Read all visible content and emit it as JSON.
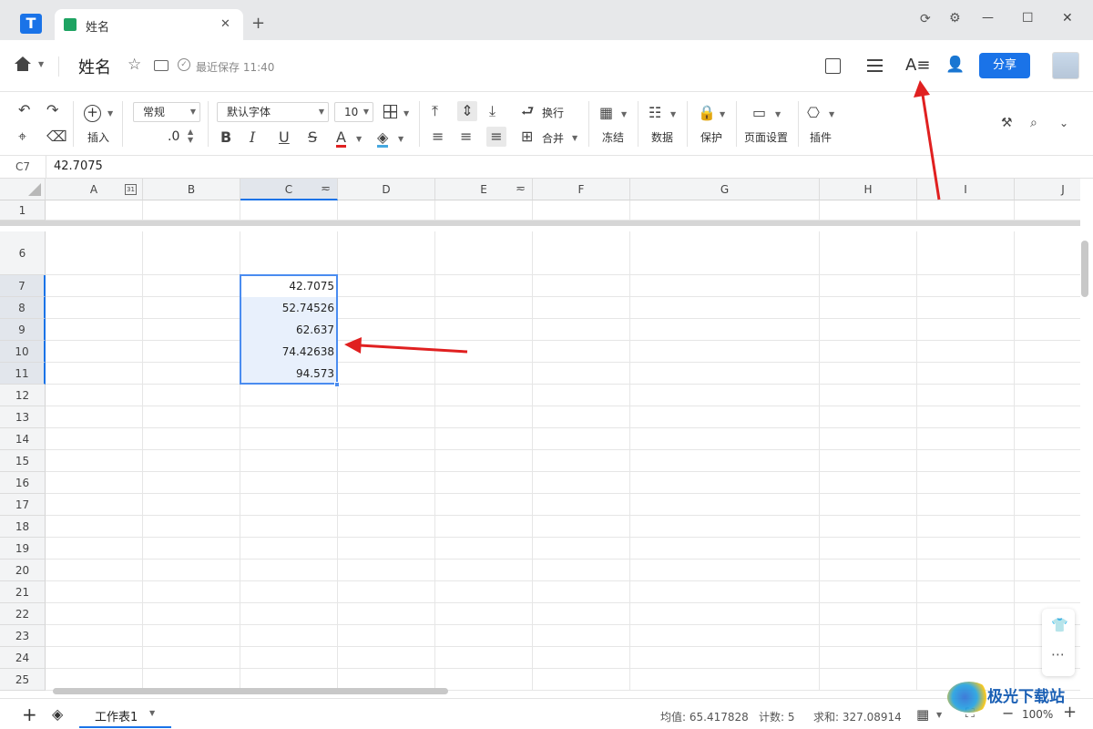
{
  "window": {
    "tab_title": "姓名",
    "new_tab": "+",
    "restore_icon": "⟳",
    "settings_icon": "⚙",
    "minimize": "—",
    "maximize": "☐",
    "close": "✕"
  },
  "doc": {
    "title": "姓名",
    "save_status": "最近保存 11:40",
    "share_label": "分享"
  },
  "toolbar": {
    "insert_label": "插入",
    "number_format": "常规",
    "decimal": ".0",
    "font_family": "默认字体",
    "font_size": "10",
    "wrap_label": "换行",
    "merge_label": "合并",
    "freeze_label": "冻结",
    "data_label": "数据",
    "protect_label": "保护",
    "page_setup_label": "页面设置",
    "plugin_label": "插件",
    "bold": "B",
    "italic": "I",
    "underline": "U",
    "strike": "S",
    "font_color": "A"
  },
  "formula_bar": {
    "cell_ref": "C7",
    "value": "42.7075"
  },
  "columns": [
    "A",
    "B",
    "C",
    "D",
    "E",
    "F",
    "G",
    "H",
    "I",
    "J"
  ],
  "rows": [
    "1",
    "6",
    "7",
    "8",
    "9",
    "10",
    "11",
    "12",
    "13",
    "14",
    "15",
    "16",
    "17",
    "18",
    "19",
    "20",
    "21",
    "22",
    "23",
    "24",
    "25"
  ],
  "cells_c": [
    "42.7075",
    "52.74526",
    "62.637",
    "74.42638",
    "94.573"
  ],
  "status": {
    "sheet_name": "工作表1",
    "average": "均值: 65.417828",
    "count": "计数: 5",
    "sum": "求和: 327.08914",
    "zoom": "100%"
  },
  "watermark": "极光下载站",
  "colors": {
    "accent": "#1a73e8",
    "selection": "#e8f0fc",
    "annotation": "#e02020"
  }
}
